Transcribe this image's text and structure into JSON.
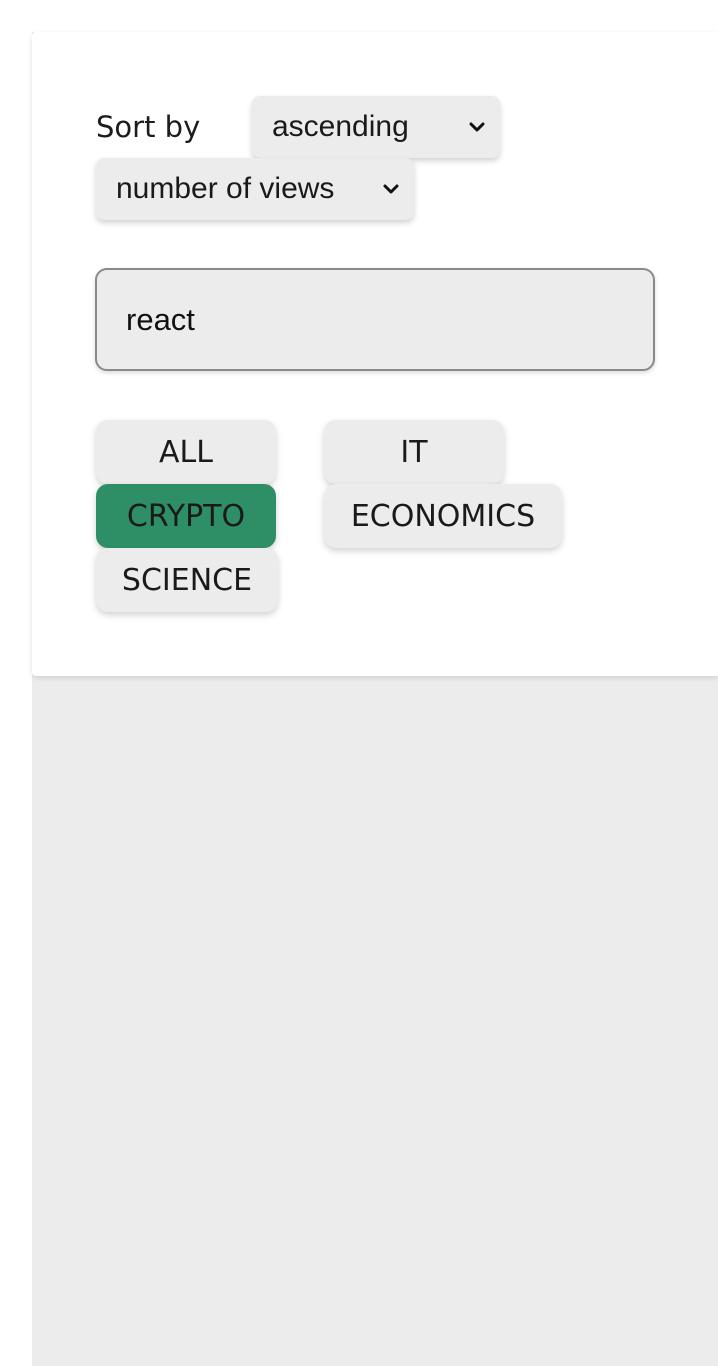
{
  "filters": {
    "sort_label": "Sort by",
    "order_select": {
      "value": "ascending",
      "icon": "chevron-down-icon"
    },
    "field_select": {
      "value": "number of views",
      "icon": "chevron-down-icon"
    }
  },
  "search": {
    "value": "react"
  },
  "categories": {
    "items": [
      {
        "label": "ALL",
        "active": false
      },
      {
        "label": "IT",
        "active": false
      },
      {
        "label": "CRYPTO",
        "active": true
      },
      {
        "label": "ECONOMICS",
        "active": false
      },
      {
        "label": "SCIENCE",
        "active": false
      }
    ],
    "active_color": "#2e8f66",
    "inactive_color": "#ececec"
  },
  "colors": {
    "page_background": "#ececec",
    "panel_background": "#ffffff"
  }
}
